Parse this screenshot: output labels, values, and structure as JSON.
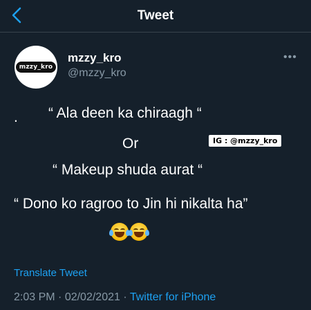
{
  "header": {
    "title": "Tweet",
    "back_icon": "chevron-left-icon"
  },
  "author": {
    "display_name": "mzzy_kro",
    "handle": "@mzzy_kro",
    "avatar_text": "mzzy_kro"
  },
  "more_icon": "more-horizontal-icon",
  "tweet": {
    "lines": [
      "“ Ala deen ka chiraagh “",
      "Or",
      "“ Makeup shuda aurat “",
      "“ Dono ko ragroo to Jin hi nikalta ha”"
    ],
    "leading_dot": ".",
    "watermark": "IG : @mzzy_kro",
    "emojis": [
      "face-with-tears-of-joy-icon",
      "face-with-tears-of-joy-icon"
    ]
  },
  "translate_label": "Translate Tweet",
  "meta": {
    "time": "2:03 PM",
    "sep1": " · ",
    "date": "02/02/2021",
    "sep2": " · ",
    "source": "Twitter for iPhone"
  },
  "colors": {
    "background": "#15202b",
    "accent": "#1da1f2",
    "secondary_text": "#8899a6"
  }
}
